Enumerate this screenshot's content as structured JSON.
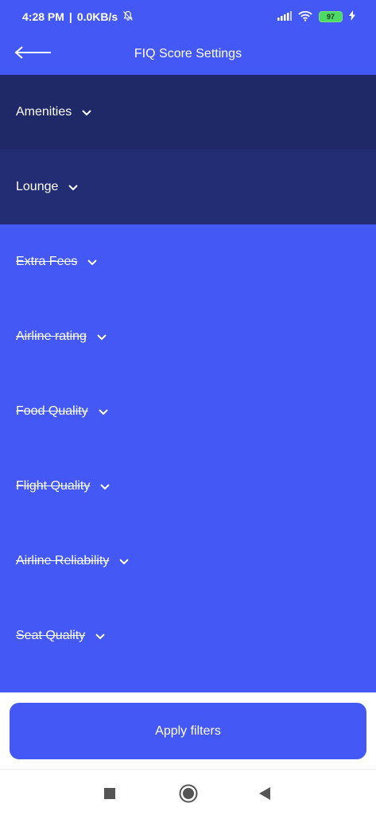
{
  "colors": {
    "primary": "#4358f4",
    "dark1": "#1f2967",
    "dark2": "#222d74"
  },
  "status_bar": {
    "time": "4:28 PM",
    "network_speed": "0.0KB/s",
    "battery": "97"
  },
  "app_bar": {
    "title": "FIQ Score Settings"
  },
  "filters": [
    {
      "label": "Amenities",
      "struck": false
    },
    {
      "label": "Lounge",
      "struck": false
    },
    {
      "label": "Extra Fees",
      "struck": true
    },
    {
      "label": "Airline rating",
      "struck": true
    },
    {
      "label": "Food Quality",
      "struck": true
    },
    {
      "label": "Flight Quality",
      "struck": true
    },
    {
      "label": "Airline Reliability",
      "struck": true
    },
    {
      "label": "Seat Quality",
      "struck": true
    }
  ],
  "apply_button": {
    "label": "Apply filters"
  },
  "icons": {
    "back": "arrow-left-icon",
    "chevron": "chevron-down-icon",
    "nav_recents": "square-icon",
    "nav_home": "circle-icon",
    "nav_back": "triangle-left-icon"
  }
}
